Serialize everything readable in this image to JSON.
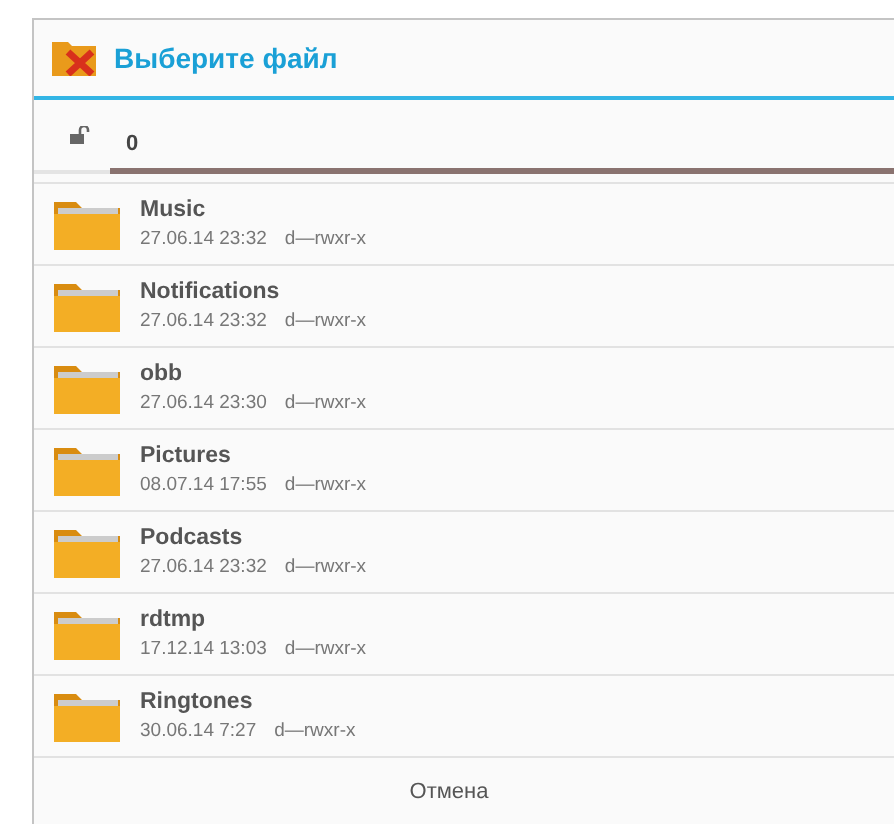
{
  "dialog": {
    "title": "Выберите файл"
  },
  "path": {
    "value": "0"
  },
  "files": [
    {
      "name": "Music",
      "date": "27.06.14 23:32",
      "perms": "d—rwxr-x"
    },
    {
      "name": "Notifications",
      "date": "27.06.14 23:32",
      "perms": "d—rwxr-x"
    },
    {
      "name": "obb",
      "date": "27.06.14 23:30",
      "perms": "d—rwxr-x"
    },
    {
      "name": "Pictures",
      "date": "08.07.14 17:55",
      "perms": "d—rwxr-x"
    },
    {
      "name": "Podcasts",
      "date": "27.06.14 23:32",
      "perms": "d—rwxr-x"
    },
    {
      "name": "rdtmp",
      "date": "17.12.14 13:03",
      "perms": "d—rwxr-x"
    },
    {
      "name": "Ringtones",
      "date": "30.06.14 7:27",
      "perms": "d—rwxr-x"
    }
  ],
  "buttons": [
    "Отмена"
  ]
}
